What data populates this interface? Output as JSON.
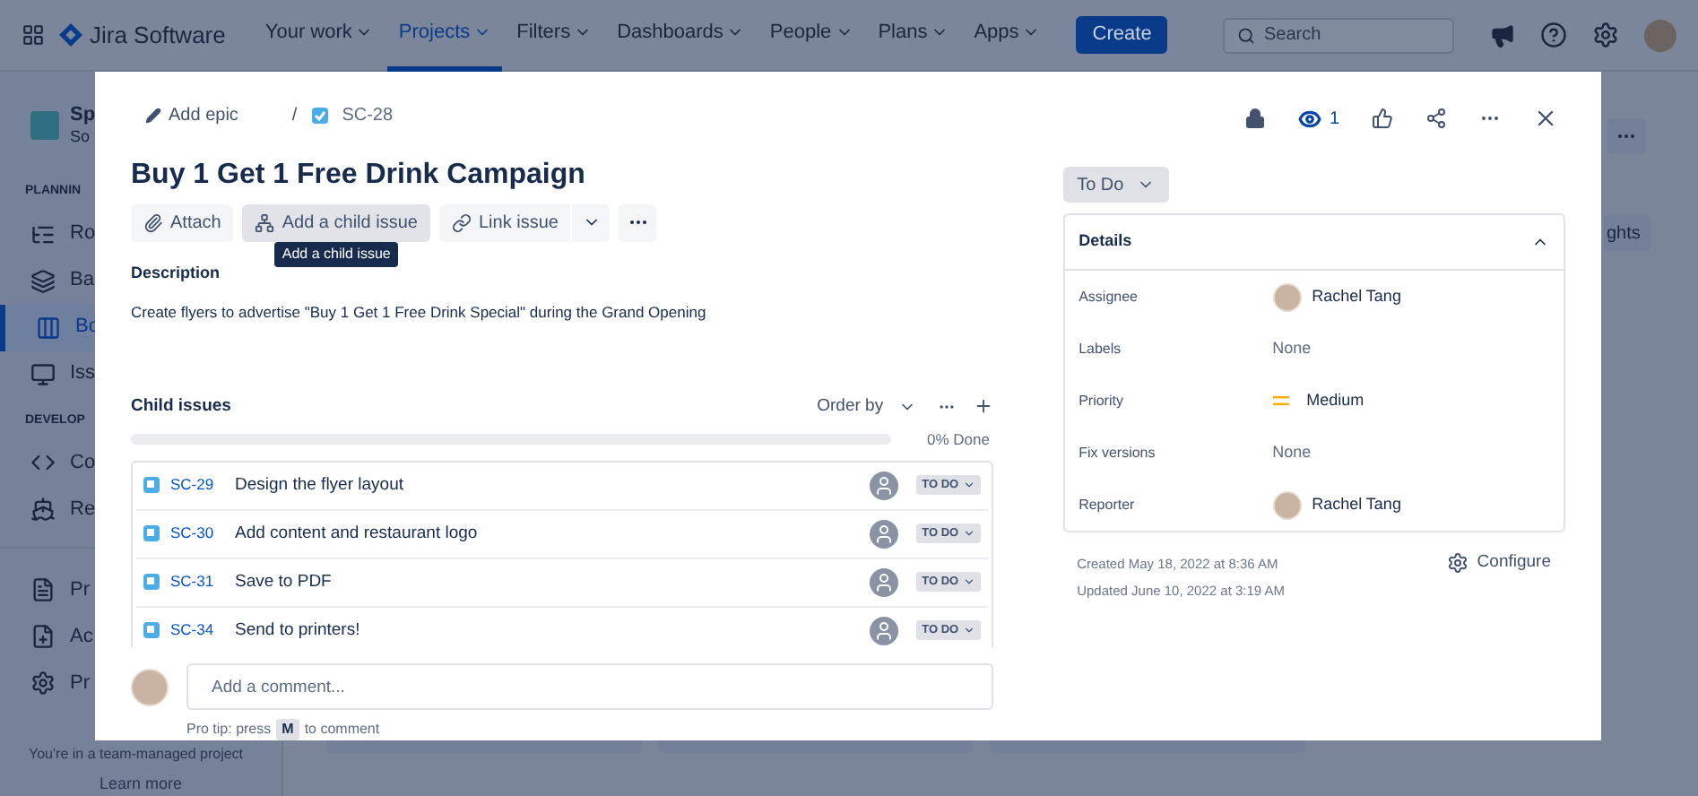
{
  "nav": {
    "product": "Jira Software",
    "items": [
      {
        "label": "Your work",
        "selected": false
      },
      {
        "label": "Projects",
        "selected": true
      },
      {
        "label": "Filters",
        "selected": false
      },
      {
        "label": "Dashboards",
        "selected": false
      },
      {
        "label": "People",
        "selected": false
      },
      {
        "label": "Plans",
        "selected": false
      },
      {
        "label": "Apps",
        "selected": false
      }
    ],
    "create": "Create",
    "search": {
      "placeholder": "Search"
    }
  },
  "sidebar": {
    "project_name": "Sp",
    "project_sub": "So",
    "sections": [
      {
        "heading": "PLANNIN",
        "items": [
          {
            "label": "Ro",
            "selected": false,
            "kind": "roadmap"
          },
          {
            "label": "Ba",
            "selected": false,
            "kind": "backlog"
          },
          {
            "label": "Bo",
            "selected": true,
            "kind": "board"
          },
          {
            "label": "Iss",
            "selected": false,
            "kind": "issues"
          }
        ]
      },
      {
        "heading": "DEVELOP",
        "items": [
          {
            "label": "Co",
            "selected": false,
            "kind": "code"
          },
          {
            "label": "Re",
            "selected": false,
            "kind": "releases"
          }
        ]
      },
      {
        "items": [
          {
            "label": "Pr",
            "selected": false,
            "kind": "pages"
          },
          {
            "label": "Ac",
            "selected": false,
            "kind": "add"
          },
          {
            "label": "Pr",
            "selected": false,
            "kind": "settings"
          }
        ]
      }
    ],
    "footer_text": "You're in a team-managed project",
    "footer_link": "Learn more"
  },
  "background": {
    "insights_button": "ghts"
  },
  "modal": {
    "breadcrumb": {
      "add_epic": "Add epic",
      "separator": "/",
      "issue_key": "SC-28"
    },
    "watchers": "1",
    "title": "Buy 1 Get 1 Free Drink Campaign",
    "actions": [
      {
        "label": "Attach",
        "kind": "attach",
        "hovered": false
      },
      {
        "label": "Add a child issue",
        "kind": "child",
        "hovered": true
      },
      {
        "label": "Link issue",
        "kind": "link",
        "hovered": false
      }
    ],
    "tooltip": "Add a child issue",
    "description": {
      "heading": "Description",
      "text": "Create flyers to advertise \"Buy 1 Get 1 Free Drink Special\" during the Grand Opening"
    },
    "child_issues": {
      "title": "Child issues",
      "order_by": "Order by",
      "level": 0,
      "reading": "0% Done",
      "items": [
        {
          "key": "SC-29",
          "summary": "Design the flyer layout",
          "status": "TO DO"
        },
        {
          "key": "SC-30",
          "summary": "Add content and restaurant logo",
          "status": "TO DO"
        },
        {
          "key": "SC-31",
          "summary": "Save to PDF",
          "status": "TO DO"
        },
        {
          "key": "SC-34",
          "summary": "Send to printers!",
          "status": "TO DO"
        }
      ]
    },
    "comment": {
      "placeholder": "Add a comment...",
      "tip_before": "Pro tip: press",
      "key": "M",
      "tip_after": "to comment"
    },
    "status": "To Do",
    "details": {
      "title": "Details",
      "expanded": true,
      "fields": [
        {
          "label": "Assignee",
          "value": "Rachel Tang",
          "kind": "user"
        },
        {
          "label": "Labels",
          "value": "None",
          "kind": "none"
        },
        {
          "label": "Priority",
          "value": "Medium",
          "kind": "priority"
        },
        {
          "label": "Fix versions",
          "value": "None",
          "kind": "none"
        },
        {
          "label": "Reporter",
          "value": "Rachel Tang",
          "kind": "user"
        }
      ]
    },
    "created": "Created May 18, 2022 at 8:36 AM",
    "updated": "Updated June 10, 2022 at 3:19 AM",
    "configure": "Configure"
  }
}
